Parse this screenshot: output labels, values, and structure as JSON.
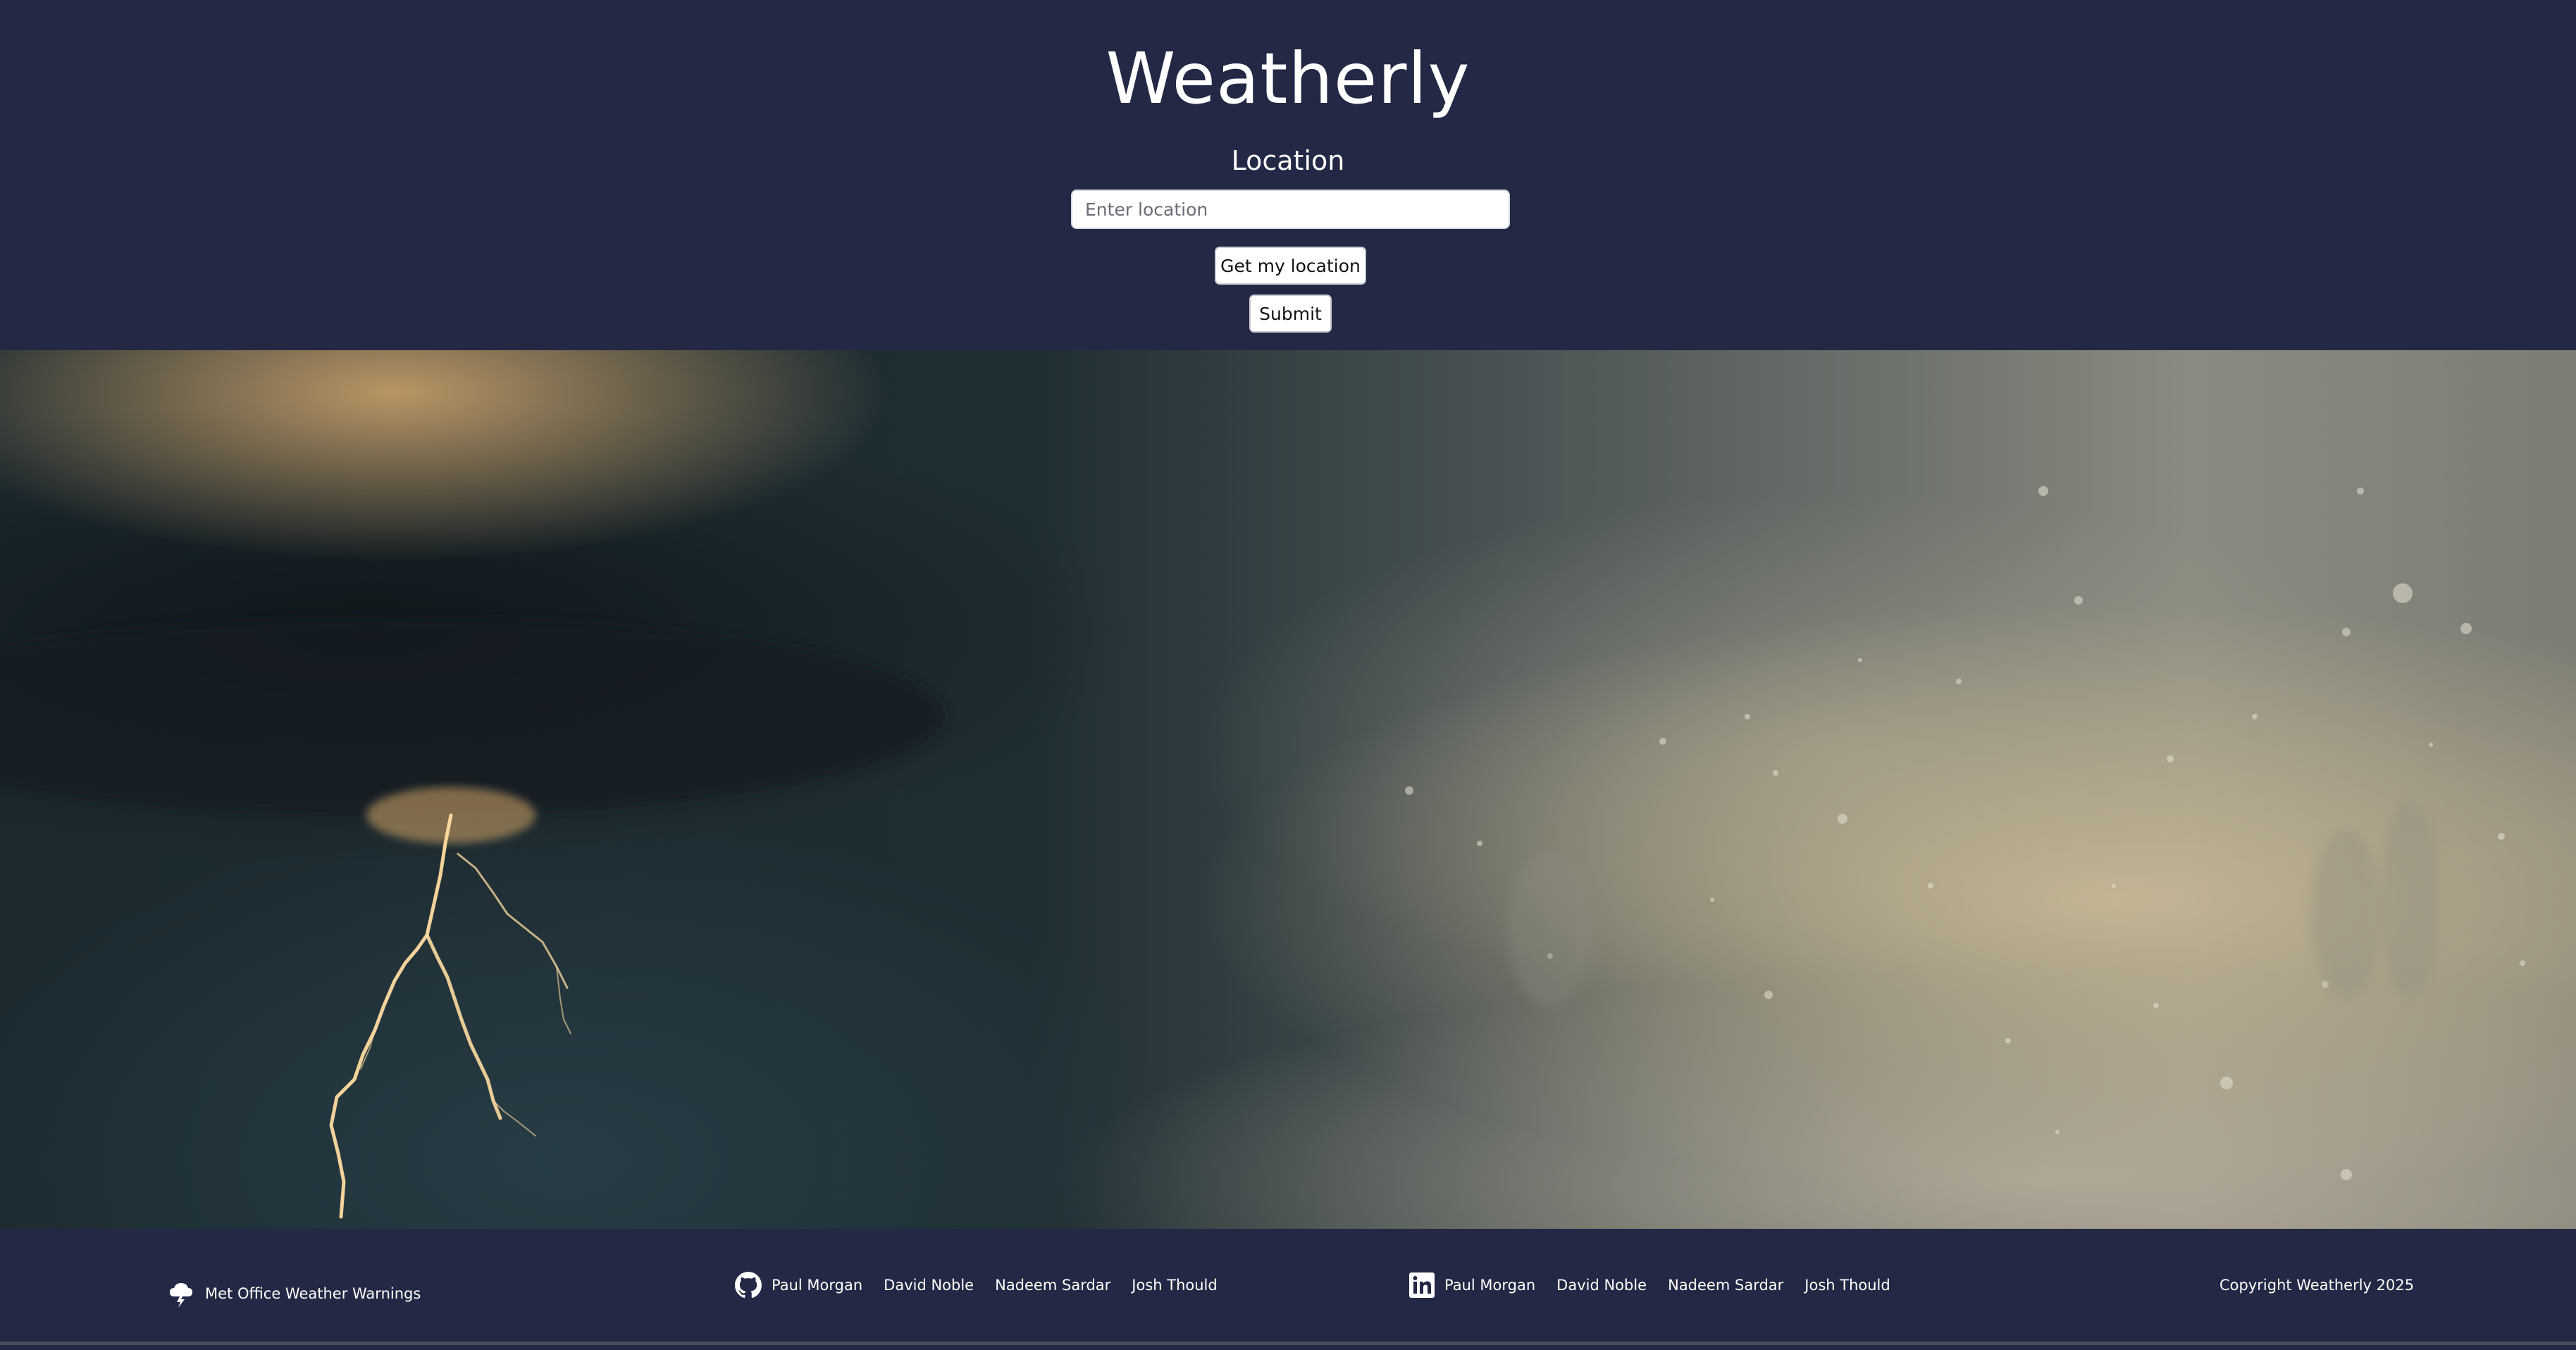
{
  "app": {
    "title": "Weatherly"
  },
  "search": {
    "label": "Location",
    "placeholder": "Enter location",
    "value": "",
    "geolocate_label": "Get my location",
    "submit_label": "Submit"
  },
  "footer": {
    "met_office_link": "Met Office Weather Warnings",
    "github": {
      "icon": "github-icon",
      "authors": [
        "Paul Morgan",
        "David Noble",
        "Nadeem Sardar",
        "Josh Thould"
      ]
    },
    "linkedin": {
      "icon": "linkedin-icon",
      "authors": [
        "Paul Morgan",
        "David Noble",
        "Nadeem Sardar",
        "Josh Thould"
      ]
    },
    "copyright": "Copyright Weatherly 2025"
  },
  "colors": {
    "background": "#232944",
    "text": "#ffffff",
    "button_bg": "#ffffff"
  }
}
